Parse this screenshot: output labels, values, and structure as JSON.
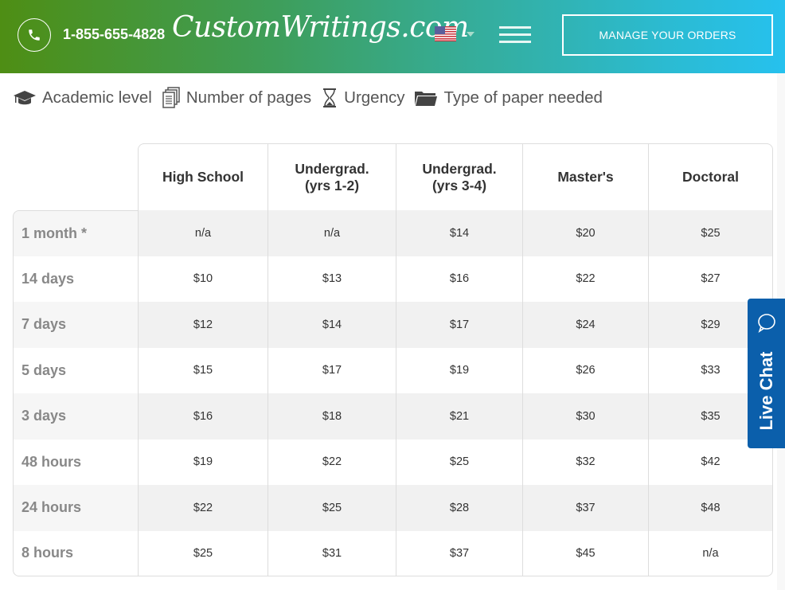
{
  "header": {
    "phone_icon": "phone-icon",
    "phone_number": "1-855-655-4828",
    "logo": "CustomWritings.com",
    "flag_icon": "us-flag-icon",
    "menu_icon": "hamburger-menu-icon",
    "manage_orders_label": "MANAGE YOUR ORDERS",
    "colors": {
      "gradient_start": "#4e8e14",
      "gradient_end": "#26c1ee"
    }
  },
  "filters": [
    {
      "icon": "graduation-cap-icon",
      "label": "Academic level"
    },
    {
      "icon": "documents-icon",
      "label": "Number of pages"
    },
    {
      "icon": "hourglass-icon",
      "label": "Urgency"
    },
    {
      "icon": "folder-icon",
      "label": "Type of paper needed"
    }
  ],
  "price_table": {
    "columns": [
      "High School",
      "Undergrad. (yrs 1-2)",
      "Undergrad. (yrs 3-4)",
      "Master's",
      "Doctoral"
    ],
    "rows": [
      {
        "label": "1 month *",
        "values": [
          "n/a",
          "n/a",
          "$14",
          "$20",
          "$25"
        ]
      },
      {
        "label": "14 days",
        "values": [
          "$10",
          "$13",
          "$16",
          "$22",
          "$27"
        ]
      },
      {
        "label": "7 days",
        "values": [
          "$12",
          "$14",
          "$17",
          "$24",
          "$29"
        ]
      },
      {
        "label": "5 days",
        "values": [
          "$15",
          "$17",
          "$19",
          "$26",
          "$33"
        ]
      },
      {
        "label": "3 days",
        "values": [
          "$16",
          "$18",
          "$21",
          "$30",
          "$35"
        ]
      },
      {
        "label": "48 hours",
        "values": [
          "$19",
          "$22",
          "$25",
          "$32",
          "$42"
        ]
      },
      {
        "label": "24 hours",
        "values": [
          "$22",
          "$25",
          "$28",
          "$37",
          "$48"
        ]
      },
      {
        "label": "8 hours",
        "values": [
          "$25",
          "$31",
          "$37",
          "$45",
          "n/a"
        ]
      }
    ]
  },
  "live_chat": {
    "label": "Live Chat",
    "icon": "chat-bubble-icon",
    "color": "#0b5fab"
  }
}
